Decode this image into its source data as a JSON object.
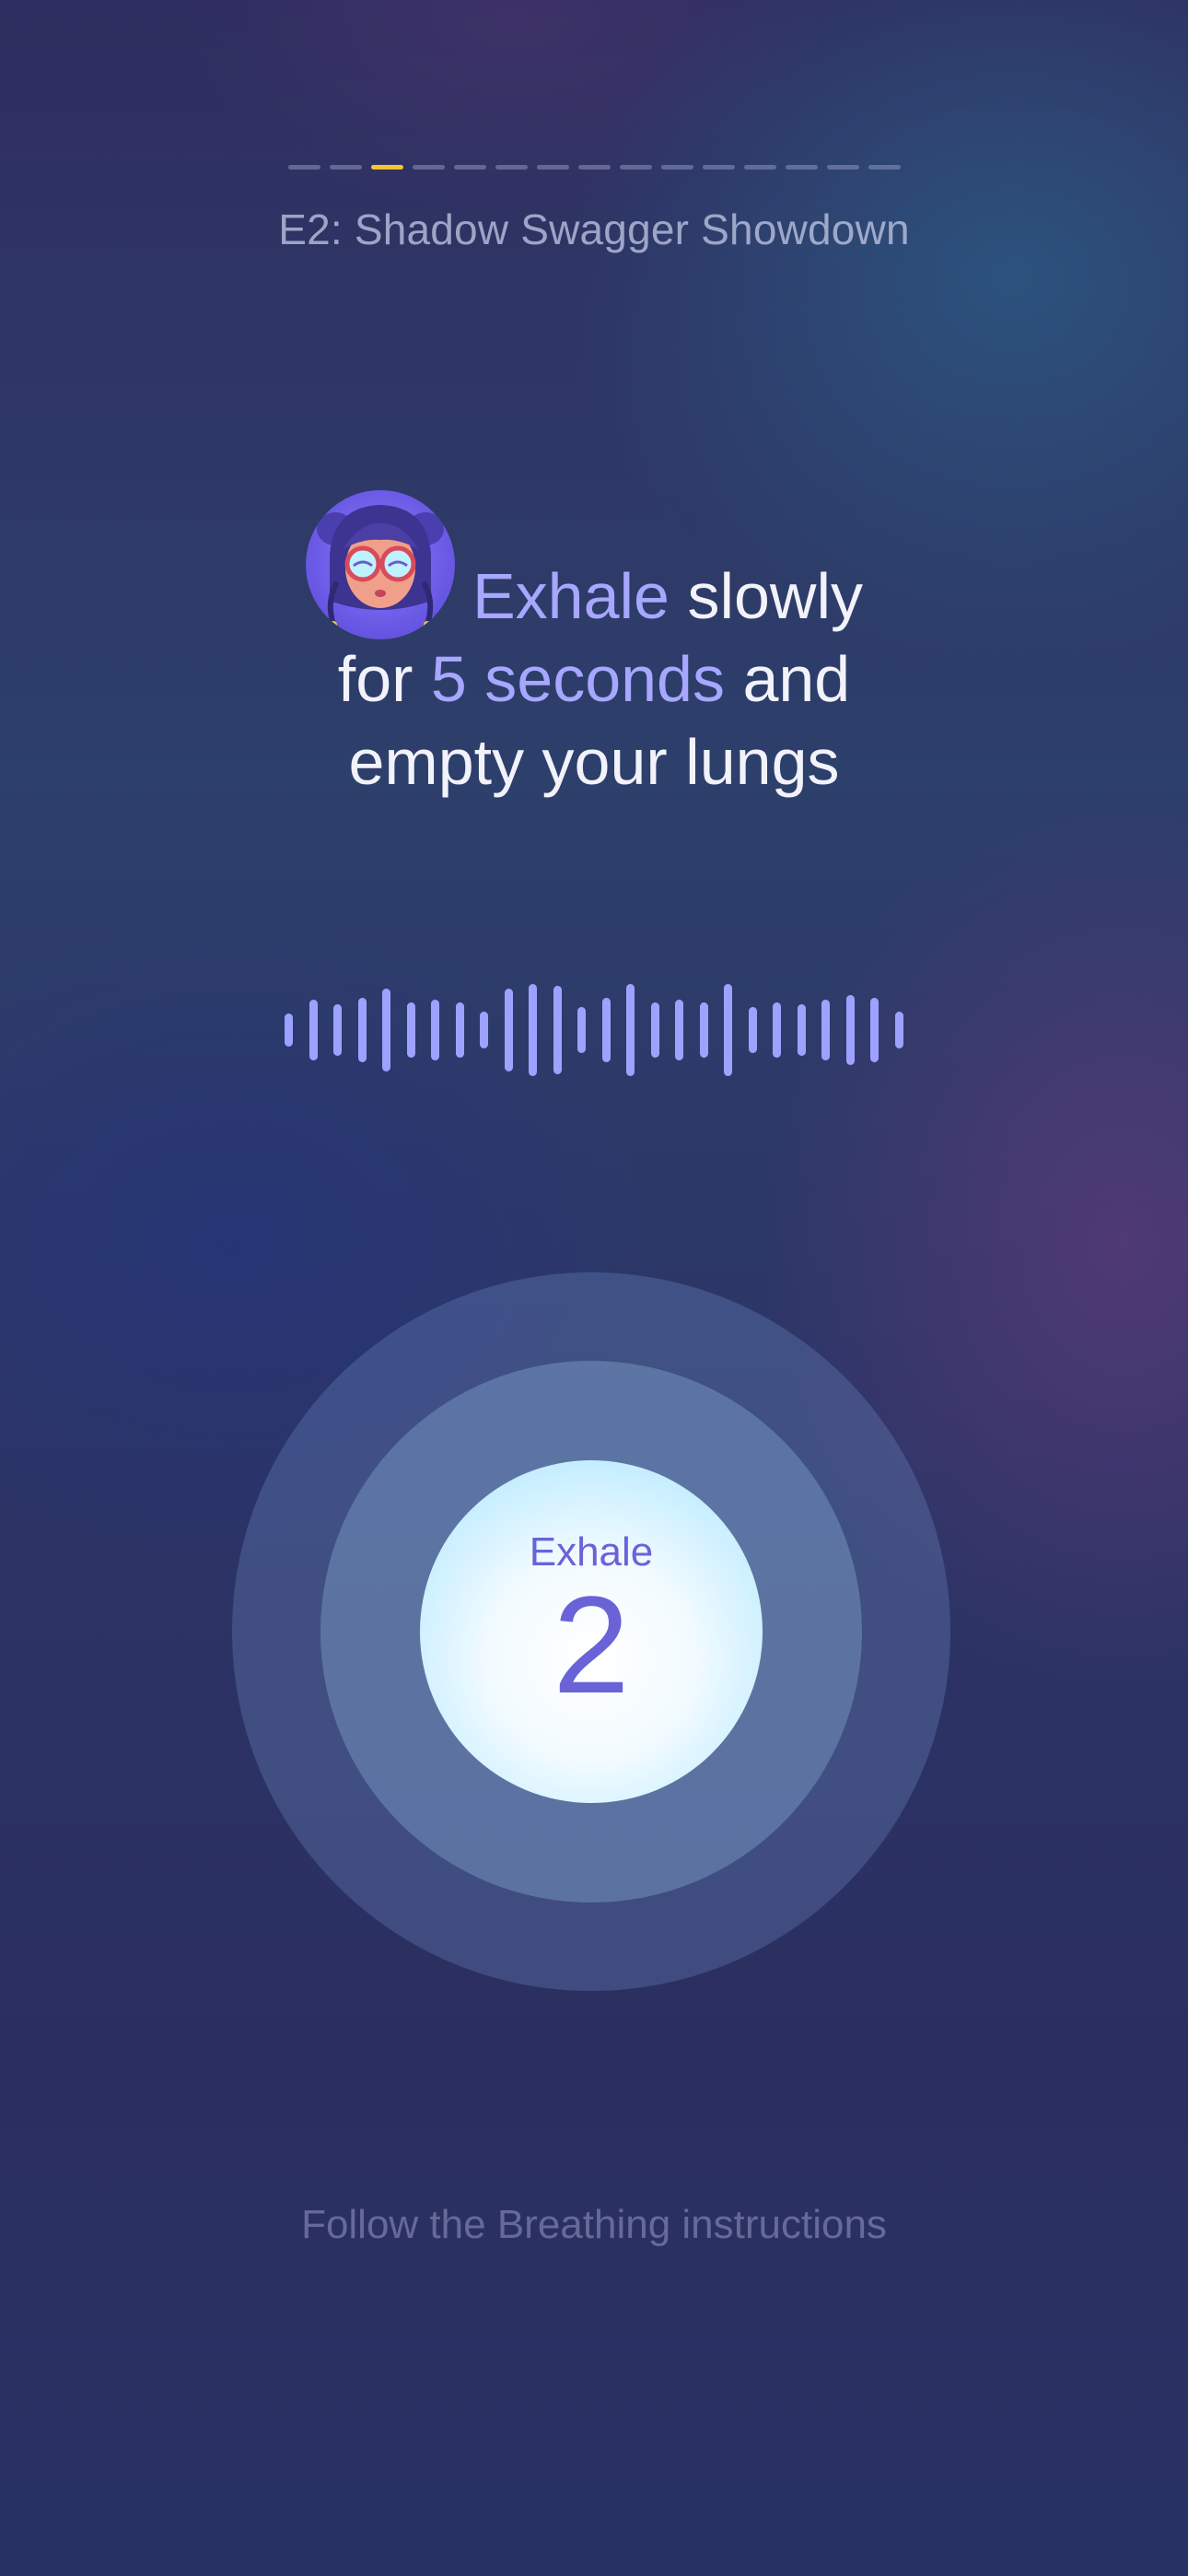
{
  "progress": {
    "total_segments": 15,
    "current_segment": 3
  },
  "episode_title": "E2: Shadow Swagger Showdown",
  "instruction": {
    "line1_highlight": "Exhale",
    "line1_rest": " slowly",
    "line2_start": "for ",
    "line2_highlight": "5 seconds",
    "line2_end": " and",
    "line3": "empty your lungs"
  },
  "breathing": {
    "phase_label": "Exhale",
    "count": "2"
  },
  "footer_hint": "Follow the Breathing instructions",
  "colors": {
    "accent_progress": "#f2c531",
    "highlight_text": "#a7a7ff",
    "waveform": "#9ea2ff",
    "counter_text": "#6a63d7"
  },
  "icons": {
    "avatar": "character-avatar"
  }
}
